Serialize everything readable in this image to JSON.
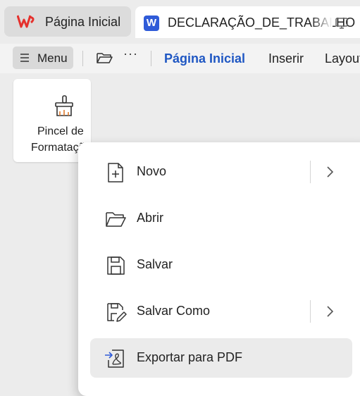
{
  "tabs": {
    "home_label": "Página Inicial",
    "doc_label": "DECLARAÇÃO_DE_TRABALHO",
    "doc_icon_letter": "W"
  },
  "toolbar": {
    "menu_label": "Menu",
    "more_label": "···",
    "ribbon_tabs": [
      "Página Inicial",
      "Inserir",
      "Layout"
    ]
  },
  "ribbon": {
    "pincel_line1": "Pincel de",
    "pincel_line2": "Formatação"
  },
  "dropdown": {
    "items": [
      {
        "label": "Novo",
        "icon": "new-file-icon",
        "has_submenu": true
      },
      {
        "label": "Abrir",
        "icon": "folder-open-icon",
        "has_submenu": false
      },
      {
        "label": "Salvar",
        "icon": "save-icon",
        "has_submenu": false
      },
      {
        "label": "Salvar Como",
        "icon": "save-as-icon",
        "has_submenu": true
      },
      {
        "label": "Exportar para PDF",
        "icon": "export-pdf-icon",
        "has_submenu": false
      }
    ]
  },
  "colors": {
    "accent": "#1f57c3",
    "wps_red": "#e5312d",
    "writer_blue": "#2f5bd8"
  }
}
